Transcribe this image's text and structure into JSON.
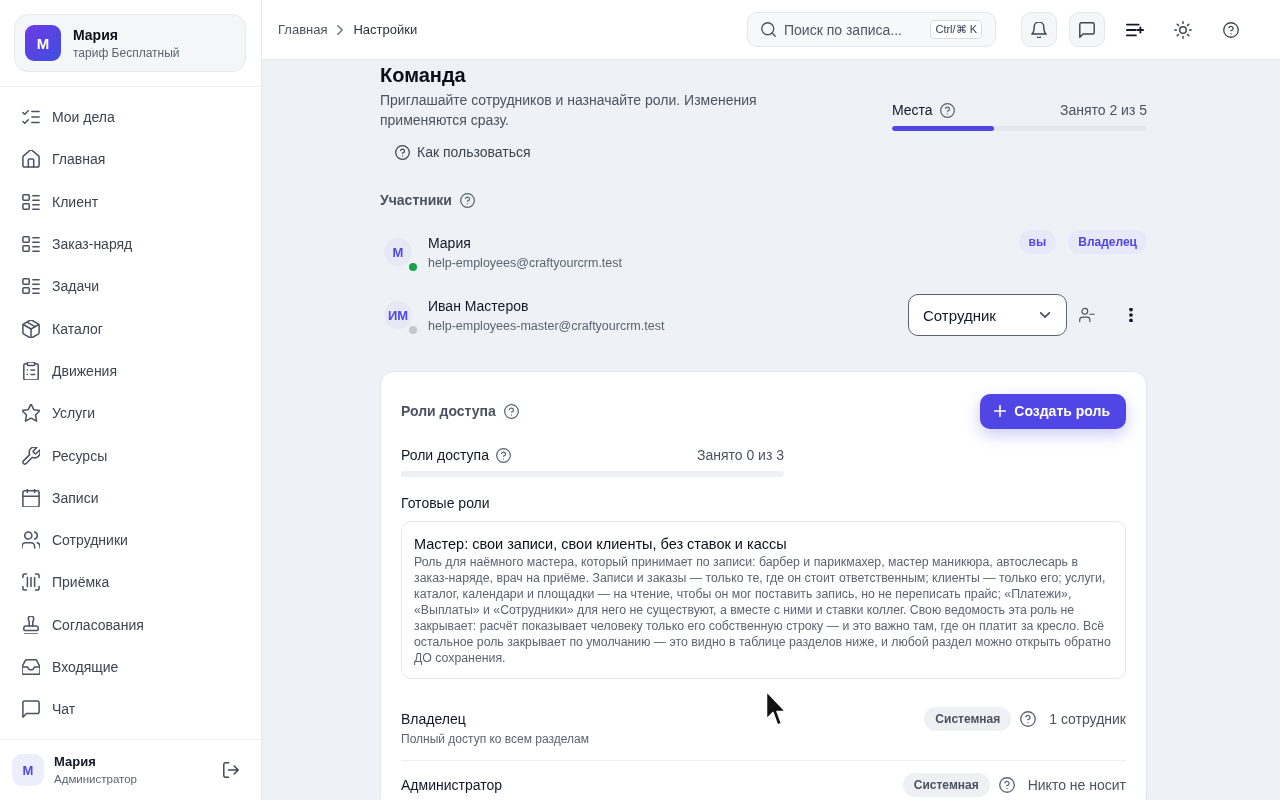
{
  "sidebar": {
    "profile": {
      "initial": "М",
      "name": "Мария",
      "plan": "тариф Бесплатный"
    },
    "items": [
      {
        "label": "Мои дела",
        "selected": false
      },
      {
        "label": "Главная",
        "selected": false
      },
      {
        "label": "Клиент",
        "selected": false
      },
      {
        "label": "Заказ-наряд",
        "selected": false
      },
      {
        "label": "Задачи",
        "selected": false
      },
      {
        "label": "Каталог",
        "selected": false
      },
      {
        "label": "Движения",
        "selected": false
      },
      {
        "label": "Услуги",
        "selected": false
      },
      {
        "label": "Ресурсы",
        "selected": false
      },
      {
        "label": "Записи",
        "selected": false
      },
      {
        "label": "Сотрудники",
        "selected": false
      },
      {
        "label": "Приёмка",
        "selected": false
      },
      {
        "label": "Согласования",
        "selected": false
      },
      {
        "label": "Входящие",
        "selected": false
      },
      {
        "label": "Чат",
        "selected": false
      }
    ],
    "user": {
      "initial": "М",
      "name": "Мария",
      "role": "Администратор"
    }
  },
  "topbar": {
    "breadcrumbs": [
      {
        "label": "Главная",
        "current": false
      },
      {
        "label": "Настройки",
        "current": true
      }
    ],
    "search": {
      "placeholder": "Поиск по записа...",
      "shortcut": "Ctrl/⌘ K"
    }
  },
  "page": {
    "title": "Команда",
    "description": "Приглашайте сотрудников и назначайте роли. Изменения применяются сразу.",
    "help_link": "Как пользоваться",
    "seats": {
      "label": "Места",
      "reading": "Занято 2 из 5",
      "level": 0.4
    }
  },
  "members": {
    "title": "Участники",
    "items": [
      {
        "kind": "badges",
        "initials": "М",
        "name": "Мария",
        "email": "help-employees@craftyourcrm.test",
        "online": true,
        "badges": [
          "вы",
          "Владелец"
        ]
      },
      {
        "kind": "select",
        "initials": "ИМ",
        "name": "Иван Мастеров",
        "email": "help-employees-master@craftyourcrm.test",
        "online": false,
        "role": "Сотрудник"
      }
    ]
  },
  "roles_card": {
    "title": "Роли доступа",
    "create_button": "Создать роль",
    "quota": {
      "label": "Роли доступа",
      "reading": "Занято 0 из 3",
      "level": 0
    },
    "presets_title": "Готовые роли",
    "presets": [
      {
        "title": "Мастер: свои записи, свои клиенты, без ставок и кассы",
        "description": "Роль для наёмного мастера, который принимает по записи: барбер и парикмахер, мастер маникюра, автослесарь в заказ-наряде, врач на приёме. Записи и заказы — только те, где он стоит ответственным; клиенты — только его; услуги, каталог, календари и площадки — на чтение, чтобы он мог поставить запись, но не переписать прайс; «Платежи», «Выплаты» и «Сотрудники» для него не существуют, а вместе с ними и ставки коллег. Свою ведомость эта роль не закрывает: расчёт показывает человеку только его собственную строку — и это важно там, где он платит за кресло. Всё остальное роль закрывает по умолчанию — это видно в таблице разделов ниже, и любой раздел можно открыть обратно ДО сохранения."
      }
    ],
    "roles": [
      {
        "name": "Владелец",
        "description": "Полный доступ ко всем разделам",
        "badge": "Системная",
        "holders": "1 сотрудник"
      },
      {
        "name": "Администратор",
        "badge": "Системная",
        "holders": "Никто не носит"
      }
    ]
  }
}
